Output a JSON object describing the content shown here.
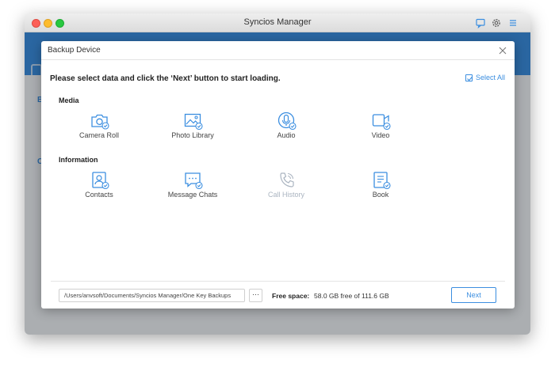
{
  "window": {
    "title": "Syncios Manager",
    "icons": [
      "chat-icon",
      "gear-icon",
      "menu-icon"
    ]
  },
  "background": {
    "letters": [
      "B",
      "C"
    ]
  },
  "dialog": {
    "title": "Backup Device",
    "instruction": "Please select data and click the ‘Next’ button to start loading.",
    "select_all": "Select All",
    "sections": {
      "media": {
        "title": "Media",
        "items": [
          {
            "label": "Camera Roll",
            "icon": "camera-icon",
            "enabled": true
          },
          {
            "label": "Photo Library",
            "icon": "photo-icon",
            "enabled": true
          },
          {
            "label": "Audio",
            "icon": "microphone-icon",
            "enabled": true
          },
          {
            "label": "Video",
            "icon": "video-icon",
            "enabled": true
          }
        ]
      },
      "information": {
        "title": "Information",
        "items": [
          {
            "label": "Contacts",
            "icon": "contacts-icon",
            "enabled": true
          },
          {
            "label": "Message Chats",
            "icon": "message-icon",
            "enabled": true
          },
          {
            "label": "Call History",
            "icon": "phone-icon",
            "enabled": false
          },
          {
            "label": "Book",
            "icon": "book-icon",
            "enabled": true
          }
        ]
      }
    },
    "footer": {
      "path": "/Users/anvsoft/Documents/Syncios Manager/One Key Backups",
      "browse": "···",
      "free_space_label": "Free space:",
      "free_space_value": "58.0 GB free of 111.6 GB",
      "next": "Next"
    }
  },
  "colors": {
    "accent": "#3b8ee0",
    "disabled": "#aab4c0"
  }
}
